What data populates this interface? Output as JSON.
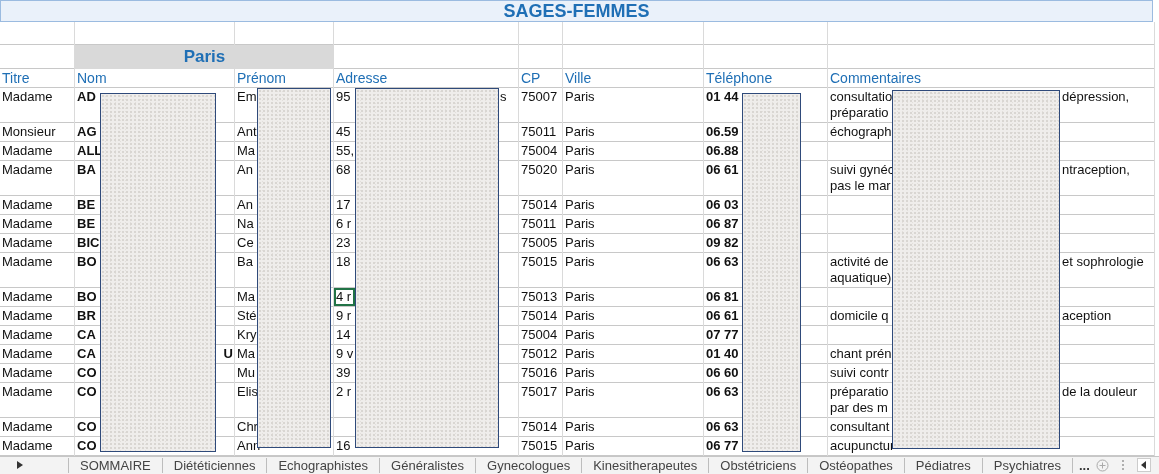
{
  "title": "SAGES-FEMMES",
  "city": "Paris",
  "columns": [
    "Titre",
    "Nom",
    "Prénom",
    "Adresse",
    "CP",
    "Ville",
    "Téléphone",
    "Commentaires"
  ],
  "rows": [
    {
      "titre": "Madame",
      "nom": "AD",
      "prenom": "Em",
      "adresse": "95",
      "adresse_end": "s",
      "cp": "75007",
      "ville": "Paris",
      "telephone": "01 44",
      "commentaire": [
        "consultatio",
        "préparatio"
      ],
      "commentaire_end": "dépression,",
      "selected": false
    },
    {
      "titre": "Monsieur",
      "nom": "AG",
      "prenom": "Ant",
      "adresse": "45",
      "cp": "75011",
      "ville": "Paris",
      "telephone": "06.59",
      "commentaire": [
        "échograph"
      ],
      "selected": false
    },
    {
      "titre": "Madame",
      "nom": "ALL",
      "prenom": "Ma",
      "adresse": "55,",
      "cp": "75004",
      "ville": "Paris",
      "telephone": "06.88",
      "selected": false
    },
    {
      "titre": "Madame",
      "nom": "BA",
      "prenom": "An",
      "adresse": "68",
      "cp": "75020",
      "ville": "Paris",
      "telephone": "06 61",
      "commentaire": [
        "suivi gynéc",
        "pas le mar"
      ],
      "commentaire_end": "ntraception,",
      "selected": false
    },
    {
      "titre": "Madame",
      "nom": "BE",
      "prenom": "An",
      "adresse": "17",
      "cp": "75014",
      "ville": "Paris",
      "telephone": "06 03",
      "selected": false
    },
    {
      "titre": "Madame",
      "nom": "BE",
      "prenom": "Na",
      "adresse": "6 r",
      "cp": "75011",
      "ville": "Paris",
      "telephone": "06 87",
      "selected": false
    },
    {
      "titre": "Madame",
      "nom": "BIC",
      "prenom": "Ce",
      "adresse": "23",
      "cp": "75005",
      "ville": "Paris",
      "telephone": "09 82",
      "selected": false
    },
    {
      "titre": "Madame",
      "nom": "BO",
      "prenom": "Ba",
      "adresse": "18",
      "cp": "75015",
      "ville": "Paris",
      "telephone": "06 63",
      "commentaire": [
        "activité de",
        "aquatique)"
      ],
      "commentaire_end": "et sophrologie",
      "selected": false
    },
    {
      "titre": "Madame",
      "nom": "BO",
      "prenom": "Ma",
      "adresse": "4 r",
      "cp": "75013",
      "ville": "Paris",
      "telephone": "06 81",
      "selected": true
    },
    {
      "titre": "Madame",
      "nom": "BR",
      "prenom": "Sté",
      "adresse": "9 r",
      "cp": "75014",
      "ville": "Paris",
      "telephone": "06 61",
      "commentaire": [
        "domicile q"
      ],
      "commentaire_end": "aception",
      "selected": false
    },
    {
      "titre": "Madame",
      "nom": "CA",
      "prenom": "Kry",
      "adresse": "14",
      "cp": "75004",
      "ville": "Paris",
      "telephone": "07 77",
      "selected": false
    },
    {
      "titre": "Madame",
      "nom": "CA",
      "nom_end": "U",
      "prenom": "Ma",
      "adresse": "9 v",
      "cp": "75012",
      "ville": "Paris",
      "telephone": "01 40",
      "commentaire": [
        "chant prén"
      ],
      "selected": false
    },
    {
      "titre": "Madame",
      "nom": "CO",
      "prenom": "Mu",
      "adresse": "39",
      "cp": "75016",
      "ville": "Paris",
      "telephone": "06 60",
      "commentaire": [
        "suivi contr"
      ],
      "selected": false
    },
    {
      "titre": "Madame",
      "nom": "CO",
      "prenom": "Elis",
      "adresse": "2 r",
      "cp": "75017",
      "ville": "Paris",
      "telephone": "06 63",
      "commentaire": [
        "préparatio",
        "par des m"
      ],
      "commentaire_end": "de la douleur",
      "selected": false
    },
    {
      "titre": "Madame",
      "nom": "CO",
      "prenom": "Chr",
      "cp": "75014",
      "ville": "Paris",
      "telephone": "06 63",
      "commentaire": [
        "consultant"
      ],
      "selected": false
    },
    {
      "titre": "Madame",
      "nom": "CO",
      "prenom": "Ann",
      "adresse": "16",
      "cp": "75015",
      "ville": "Paris",
      "telephone": "06 77",
      "commentaire": [
        "acupunctur"
      ],
      "selected": false
    }
  ],
  "sheet_tabs": [
    "SOMMAIRE",
    "Diététiciennes",
    "Echographistes",
    "Généralistes",
    "Gynecologues",
    "Kinesitherapeutes",
    "Obstétriciens",
    "Ostéopathes",
    "Pédiatres",
    "Psychiatres"
  ],
  "more_tabs": "..."
}
